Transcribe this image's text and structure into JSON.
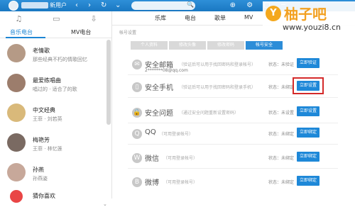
{
  "topbar": {
    "user_name": "新用户",
    "nav_back": "‹",
    "nav_forward": "›",
    "nav_refresh": "↻",
    "nav_down": "⌄",
    "search_icon": "🔍",
    "mini_icons": "⊕ ⚙ ▢ ─"
  },
  "watermark": {
    "logo": "Y",
    "title": "柚子吧",
    "url": "www.youzi8.cn"
  },
  "left": {
    "icon_music": "♫",
    "icon_video": "▭",
    "icon_download": "⇩",
    "tab_radio": "音乐电台",
    "tab_mv": "MV电台",
    "items": [
      {
        "name": "老情歌",
        "sub": "那些经典不朽的情歌回忆"
      },
      {
        "name": "最爱练唱曲",
        "sub": "唱过的 · 适合了的歌"
      },
      {
        "name": "中文经典",
        "sub": "王菲 · 刘若英"
      },
      {
        "name": "梅艳芳",
        "sub": "王菲 · 林忆莲"
      },
      {
        "name": "孙燕",
        "sub": "孙燕姿"
      },
      {
        "name": "猜你喜欢",
        "sub": ""
      }
    ],
    "bottom_arrow": "⌄"
  },
  "main": {
    "nav": [
      "乐库",
      "电台",
      "歌单",
      "MV"
    ],
    "breadcrumb": "帐号设置",
    "tabs": [
      "个人资料",
      "修改头像",
      "修改密码",
      "帐号安全"
    ],
    "rows": [
      {
        "icon": "✉",
        "title": "安全邮箱",
        "desc": "（验证后可以用于找回密码和登录帐号）",
        "sub": "2*******08@qq.com",
        "status": "状态：未验证",
        "button": "立即验证"
      },
      {
        "icon": "▯",
        "title": "安全手机",
        "desc": "（验证后可以用于找回密码和登录手机）",
        "sub": "",
        "status": "状态：未绑定",
        "button": "立即设置"
      },
      {
        "icon": "🔒",
        "title": "安全问题",
        "desc": "（通过安全问题重新设置密码）",
        "sub": "",
        "status": "状态：未设置",
        "button": "立即设置"
      },
      {
        "icon": "Q",
        "title": "QQ",
        "desc": "（可用登录帐号）",
        "sub": "",
        "status": "状态：未绑定",
        "button": "立即绑定"
      },
      {
        "icon": "W",
        "title": "微信",
        "desc": "（可用登录帐号）",
        "sub": "",
        "status": "状态：未绑定",
        "button": "立即绑定"
      },
      {
        "icon": "B",
        "title": "微博",
        "desc": "（可用登录帐号）",
        "sub": "",
        "status": "状态：未绑定",
        "button": "立即绑定"
      }
    ]
  }
}
